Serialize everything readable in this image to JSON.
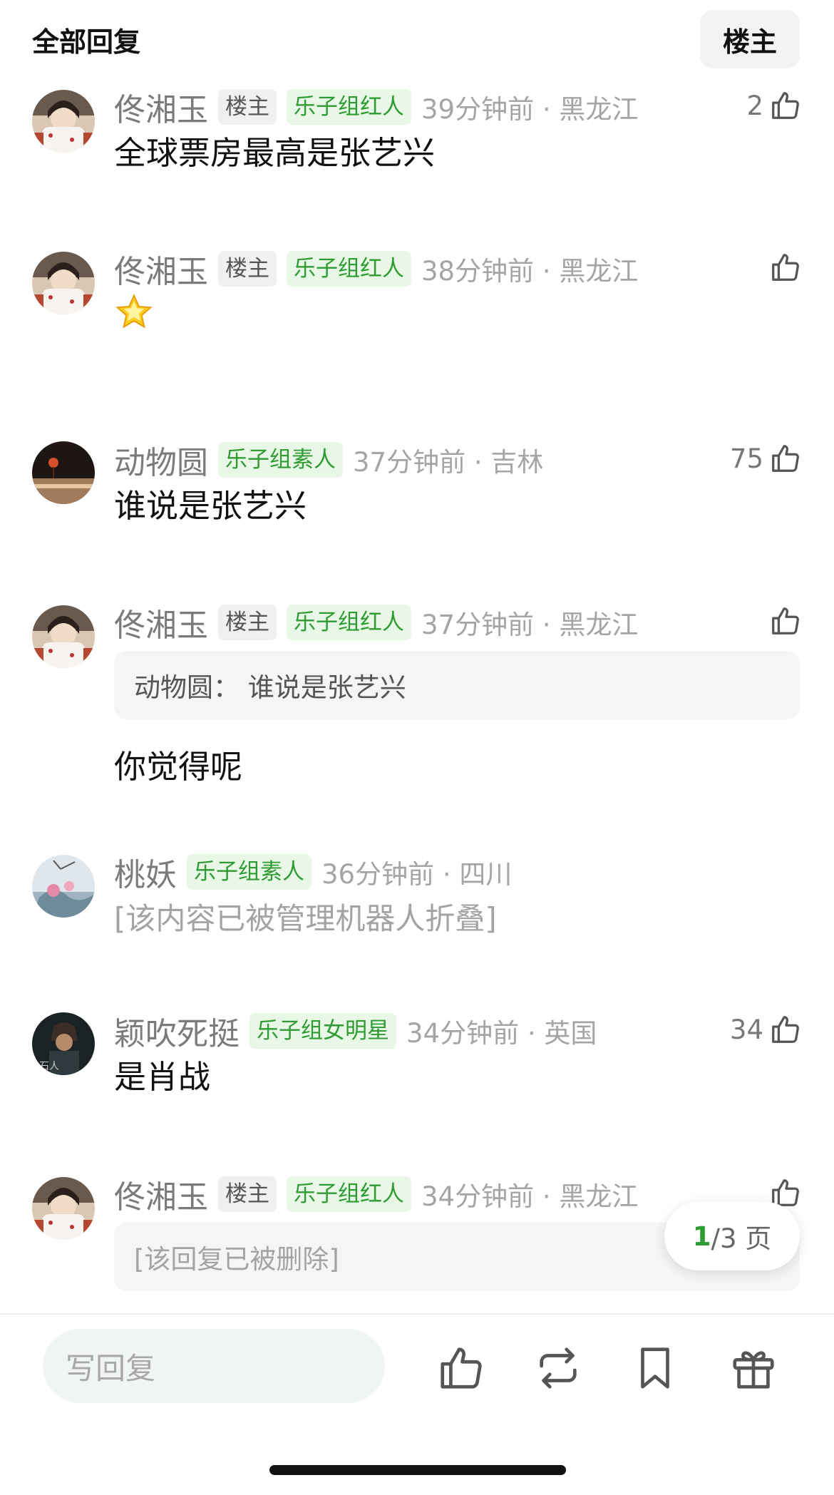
{
  "header": {
    "title": "全部回复",
    "op_filter": "楼主"
  },
  "comments": [
    {
      "username": "佟湘玉",
      "op_badge": "楼主",
      "group_badge": "乐子组红人",
      "time": "39分钟前 · 黑龙江",
      "likes": "2",
      "text": "全球票房最高是张艺兴"
    },
    {
      "username": "佟湘玉",
      "op_badge": "楼主",
      "group_badge": "乐子组红人",
      "time": "38分钟前 · 黑龙江",
      "likes": "",
      "emoji": "🌟"
    },
    {
      "username": "动物圆",
      "group_badge": "乐子组素人",
      "time": "37分钟前 · 吉林",
      "likes": "75",
      "text": "谁说是张艺兴"
    },
    {
      "username": "佟湘玉",
      "op_badge": "楼主",
      "group_badge": "乐子组红人",
      "time": "37分钟前 · 黑龙江",
      "likes": "",
      "quote": "动物圆：  谁说是张艺兴",
      "text": "你觉得呢"
    },
    {
      "username": "桃妖",
      "group_badge": "乐子组素人",
      "time": "36分钟前 · 四川",
      "likes": "",
      "folded": "[该内容已被管理机器人折叠]"
    },
    {
      "username": "颖吹死挺",
      "group_badge": "乐子组女明星",
      "time": "34分钟前 · 英国",
      "likes": "34",
      "text": "是肖战"
    },
    {
      "username": "佟湘玉",
      "op_badge": "楼主",
      "group_badge": "乐子组红人",
      "time": "34分钟前 · 黑龙江",
      "likes": "",
      "quote": "[该回复已被删除]"
    }
  ],
  "pager": {
    "current": "1",
    "total": "/3 页"
  },
  "bottom_bar": {
    "reply_placeholder": "写回复"
  },
  "colors": {
    "accent_green": "#2f9b33",
    "badge_green_bg": "#e9f7e7",
    "muted_text": "#a5a5a5"
  }
}
